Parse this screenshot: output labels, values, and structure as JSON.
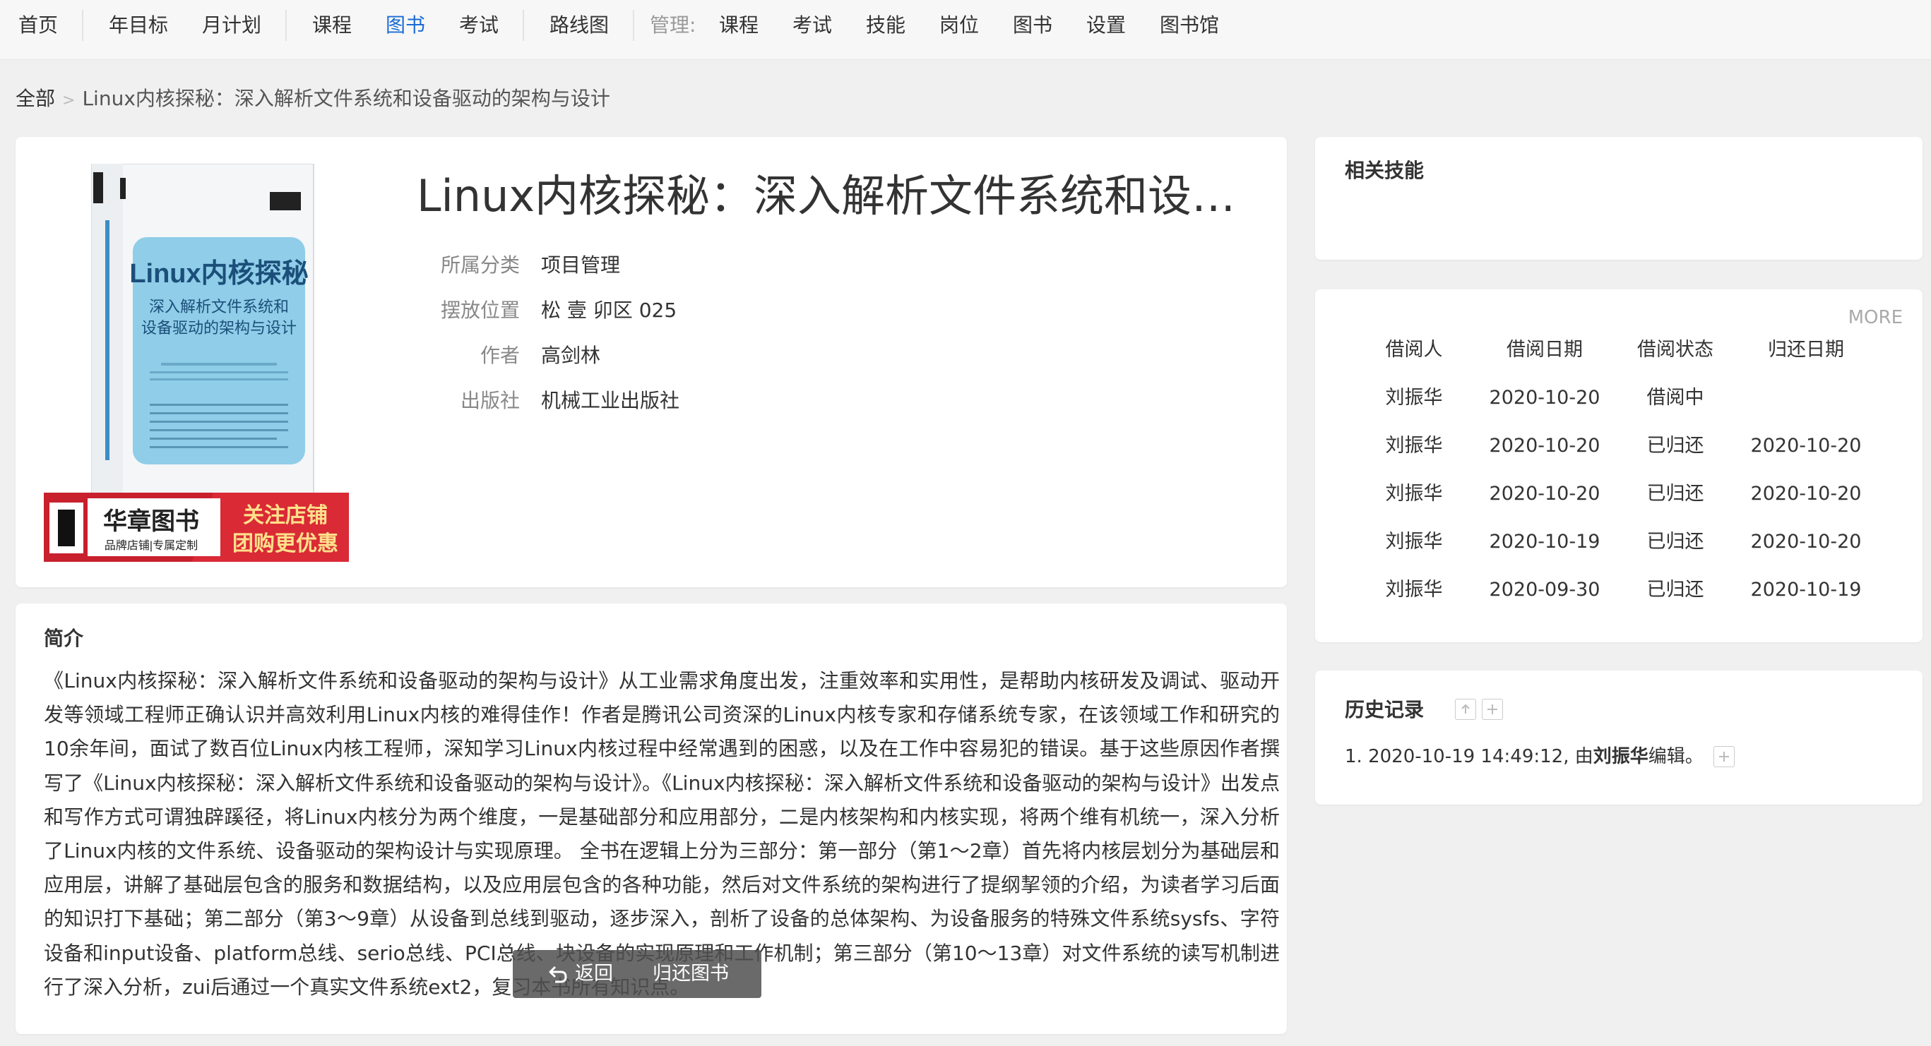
{
  "nav": {
    "items": [
      {
        "label": "首页"
      },
      {
        "label": "年目标"
      },
      {
        "label": "月计划"
      },
      {
        "label": "课程"
      },
      {
        "label": "图书"
      },
      {
        "label": "考试"
      },
      {
        "label": "路线图"
      }
    ],
    "manage_label": "管理:",
    "manage_items": [
      {
        "label": "课程"
      },
      {
        "label": "考试"
      },
      {
        "label": "技能"
      },
      {
        "label": "岗位"
      },
      {
        "label": "图书"
      },
      {
        "label": "设置"
      },
      {
        "label": "图书馆"
      }
    ],
    "active_item": "图书",
    "active_color": "#1a6bd6"
  },
  "breadcrumb": {
    "root": "全部",
    "separator": ">",
    "current": "Linux内核探秘：深入解析文件系统和设备驱动的架构与设计"
  },
  "book": {
    "title": "Linux内核探秘：深入解析文件系统和设备驱动的架构与设计",
    "cover": {
      "title_big": "Linux内核探秘",
      "subtitle_1": "深入解析文件系统和",
      "subtitle_2": "设备驱动的架构与设计",
      "banner_brand": "华章图书",
      "banner_brand_sub": "品牌店铺|专属定制",
      "banner_cta_1": "关注店铺",
      "banner_cta_2": "团购更优惠"
    },
    "fields": [
      {
        "label": "所属分类",
        "value": "项目管理"
      },
      {
        "label": "摆放位置",
        "value": "松 壹 卯区 025"
      },
      {
        "label": "作者",
        "value": "高剑林"
      },
      {
        "label": "出版社",
        "value": "机械工业出版社"
      }
    ]
  },
  "intro": {
    "heading": "简介",
    "text": "《Linux内核探秘：深入解析文件系统和设备驱动的架构与设计》从工业需求角度出发，注重效率和实用性，是帮助内核研发及调试、驱动开发等领域工程师正确认识并高效利用Linux内核的难得佳作！作者是腾讯公司资深的Linux内核专家和存储系统专家，在该领域工作和研究的10余年间，面试了数百位Linux内核工程师，深知学习Linux内核过程中经常遇到的困惑，以及在工作中容易犯的错误。基于这些原因作者撰写了《Linux内核探秘：深入解析文件系统和设备驱动的架构与设计》。《Linux内核探秘：深入解析文件系统和设备驱动的架构与设计》出发点和写作方式可谓独辟蹊径，将Linux内核分为两个维度，一是基础部分和应用部分，二是内核架构和内核实现，将两个维有机统一，深入分析了Linux内核的文件系统、设备驱动的架构设计与实现原理。 全书在逻辑上分为三部分：第一部分（第1～2章）首先将内核层划分为基础层和应用层，讲解了基础层包含的服务和数据结构，以及应用层包含的各种功能，然后对文件系统的架构进行了提纲挈领的介绍，为读者学习后面的知识打下基础；第二部分（第3～9章）从设备到总线到驱动，逐步深入，剖析了设备的总体架构、为设备服务的特殊文件系统sysfs、字符设备和input设备、platform总线、serio总线、PCI总线、块设备的实现原理和工作机制；第三部分（第10～13章）对文件系统的读写机制进行了深入分析，zui后通过一个真实文件系统ext2，复习本书所有知识点。"
  },
  "skills": {
    "heading": "相关技能"
  },
  "borrow": {
    "more_label": "MORE",
    "headers": [
      "借阅人",
      "借阅日期",
      "借阅状态",
      "归还日期"
    ],
    "rows": [
      [
        "刘振华",
        "2020-10-20",
        "借阅中",
        ""
      ],
      [
        "刘振华",
        "2020-10-20",
        "已归还",
        "2020-10-20"
      ],
      [
        "刘振华",
        "2020-10-20",
        "已归还",
        "2020-10-20"
      ],
      [
        "刘振华",
        "2020-10-19",
        "已归还",
        "2020-10-20"
      ],
      [
        "刘振华",
        "2020-09-30",
        "已归还",
        "2020-10-19"
      ]
    ]
  },
  "history": {
    "heading": "历史记录",
    "entry_prefix": "1. 2020-10-19 14:49:12, 由 ",
    "entry_user": "刘振华",
    "entry_suffix": " 编辑。"
  },
  "actions": {
    "back_label": "返回",
    "return_label": "归还图书"
  }
}
